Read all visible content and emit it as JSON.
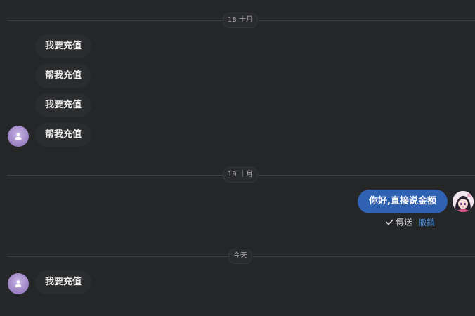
{
  "dates": {
    "first": "18 十月",
    "second": "19 十月",
    "today": "今天"
  },
  "messages": {
    "m1": "我要充值",
    "m2": "帮我充值",
    "m3": "我要充值",
    "m4": "帮我充值",
    "reply": "你好,直接说金额",
    "m5": "我要充值"
  },
  "status": {
    "sent_label": "傳送",
    "recall_label": "撤銷"
  },
  "colors": {
    "background": "#252627",
    "incoming_bubble": "#2b2c2e",
    "outgoing_bubble": "#2f62b3",
    "link": "#4a8fe0"
  },
  "icons": {
    "user_avatar": "user-silhouette-icon",
    "agent_avatar": "anime-girl-avatar",
    "sent_check": "check-icon"
  }
}
